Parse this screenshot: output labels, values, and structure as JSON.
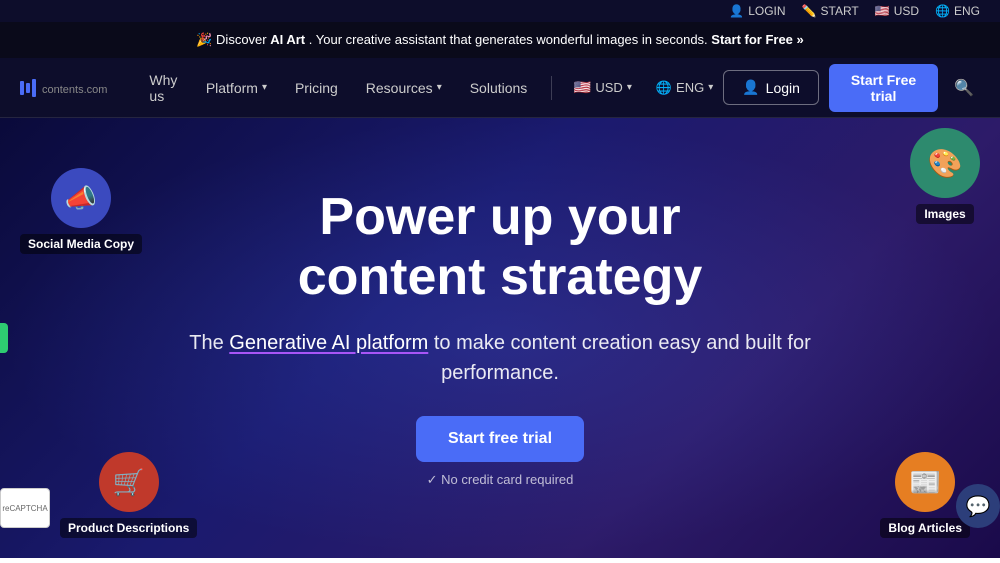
{
  "utility_bar": {
    "login_label": "LOGIN",
    "start_label": "START",
    "usd_label": "USD",
    "eng_label": "ENG"
  },
  "announcement": {
    "emoji": "🎉",
    "prefix": "Discover ",
    "highlight": "AI Art",
    "middle": ". Your creative assistant that generates wonderful images in seconds. ",
    "cta": "Start for Free »"
  },
  "navbar": {
    "logo_text": "contents.",
    "logo_sub": "com",
    "why_us": "Why us",
    "platform": "Platform",
    "pricing": "Pricing",
    "resources": "Resources",
    "solutions": "Solutions",
    "currency": "USD",
    "language": "ENG",
    "login_btn": "Login",
    "trial_btn": "Start Free trial"
  },
  "hero": {
    "title_line1": "Power up your",
    "title_line2": "content strategy",
    "subtitle_before": "The ",
    "subtitle_link": "Generative AI platform",
    "subtitle_after": " to make content creation easy and built for performance.",
    "cta_btn": "Start free trial",
    "no_cc_text": "No credit card required"
  },
  "floating": {
    "social_icon": "📣",
    "social_label": "Social Media Copy",
    "product_icon": "🛒",
    "product_label": "Product Descriptions",
    "images_icon": "🎨",
    "images_label": "Images",
    "blog_icon": "📰",
    "blog_label": "Blog Articles"
  },
  "chat": {
    "icon": "💬"
  }
}
